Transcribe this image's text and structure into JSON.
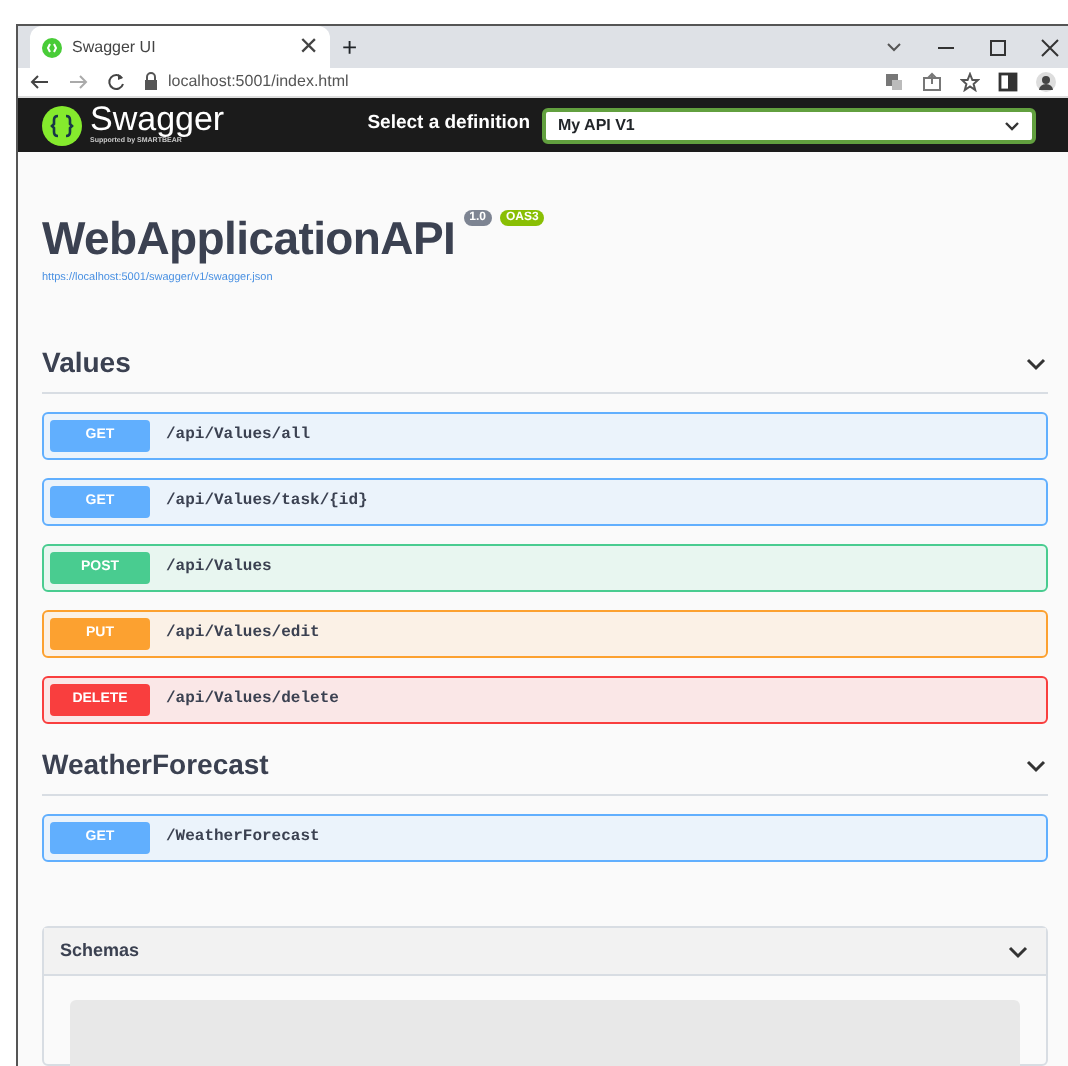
{
  "browser": {
    "tab_title": "Swagger UI",
    "tab_close": "×",
    "new_tab": "+",
    "address": "localhost:5001/index.html"
  },
  "header": {
    "brand": "Swagger",
    "brand_sub": "Supported by SMARTBEAR",
    "select_label": "Select a definition",
    "definition": "My API V1"
  },
  "info": {
    "title": "WebApplicationAPI",
    "version": "1.0",
    "oas": "OAS3",
    "url": "https://localhost:5001/swagger/v1/swagger.json"
  },
  "sections": [
    {
      "name": "Values",
      "expanded": true,
      "operations": [
        {
          "method": "GET",
          "path": "/api/Values/all"
        },
        {
          "method": "GET",
          "path": "/api/Values/task/{id}"
        },
        {
          "method": "POST",
          "path": "/api/Values"
        },
        {
          "method": "PUT",
          "path": "/api/Values/edit"
        },
        {
          "method": "DELETE",
          "path": "/api/Values/delete"
        }
      ]
    },
    {
      "name": "WeatherForecast",
      "expanded": true,
      "operations": [
        {
          "method": "GET",
          "path": "/WeatherForecast"
        }
      ]
    }
  ],
  "schemas": {
    "title": "Schemas",
    "expanded": true
  }
}
